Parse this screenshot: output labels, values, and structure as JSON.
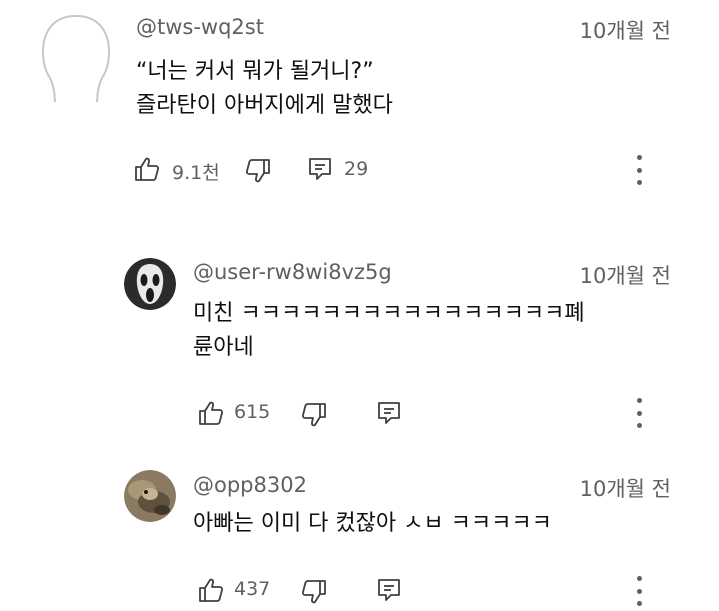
{
  "comments": [
    {
      "handle": "@tws-wq2st",
      "time": "10개월 전",
      "lines": [
        "“너는 커서 뭐가 될거니?”",
        "즐라탄이 아버지에게 말했다"
      ],
      "likes": "9.1천",
      "replies": "29",
      "avatar_icon": "default-head-silhouette"
    }
  ],
  "replies": [
    {
      "handle": "@user-rw8wi8vz5g",
      "time": "10개월 전",
      "lines": [
        "미친 ㅋㅋㅋㅋㅋㅋㅋㅋㅋㅋㅋㅋㅋㅋㅋㅋ폐",
        "륜아네"
      ],
      "likes": "615",
      "avatar_icon": "ghostface-mask-avatar"
    },
    {
      "handle": "@opp8302",
      "time": "10개월 전",
      "lines": [
        "아빠는 이미 다 컸잖아 ㅅㅂ ㅋㅋㅋㅋㅋ"
      ],
      "likes": "437",
      "avatar_icon": "animal-photo-avatar"
    }
  ],
  "colors": {
    "text": "#0f0f0f",
    "secondary": "#606060",
    "background": "#ffffff"
  }
}
